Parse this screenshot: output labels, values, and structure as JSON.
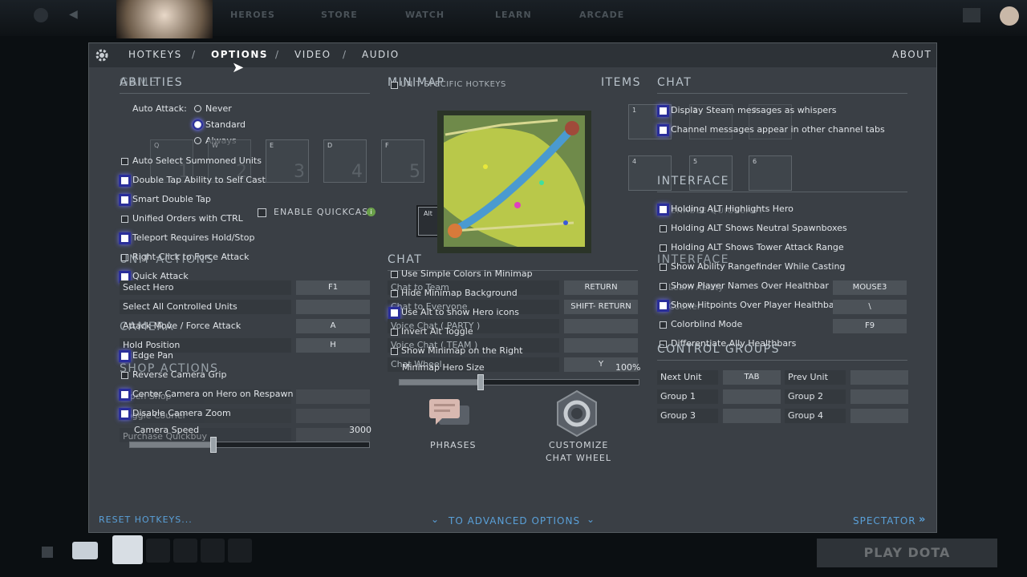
{
  "topnav": [
    "HEROES",
    "STORE",
    "WATCH",
    "LEARN",
    "ARCADE"
  ],
  "tabs": {
    "hotkeys": "HOTKEYS",
    "options": "OPTIONS",
    "video": "VIDEO",
    "audio": "AUDIO",
    "about": "ABOUT",
    "sep": "/"
  },
  "headers": {
    "abilities": "ABILITIES",
    "game": "GAME",
    "minimap": "MINIMAP",
    "items": "ITEMS",
    "chat": "CHAT",
    "interface": "INTERFACE",
    "unit_actions": "UNIT ACTIONS",
    "camera": "CAMERA",
    "shop_actions": "SHOP ACTIONS",
    "chat2": "CHAT",
    "interface2": "INTERFACE",
    "control_groups": "CONTROL GROUPS"
  },
  "unit_specific": "UNIT SPECIFIC HOTKEYS",
  "auto_attack": {
    "label": "Auto Attack:",
    "options": [
      "Never",
      "Standard",
      "Always"
    ],
    "selected": "Standard"
  },
  "ability_slots": [
    {
      "key": "Q",
      "num": ""
    },
    {
      "key": "W",
      "num": "2"
    },
    {
      "key": "E",
      "num": "3"
    },
    {
      "key": "D",
      "num": "4"
    },
    {
      "key": "F",
      "num": "5"
    }
  ],
  "ghost_slot_num": "1",
  "game_options": [
    "Auto Select Summoned Units",
    "Double Tap Ability to Self Cast",
    "Smart Double Tap",
    "Unified Orders with CTRL",
    "Teleport Requires Hold/Stop",
    "Right-Click to Force Attack",
    "Quick Attack"
  ],
  "enable_quickcast": "ENABLE QUICKCAST",
  "alt_key": "Alt",
  "unit_actions": [
    {
      "label": "Select Hero",
      "key": "F1"
    },
    {
      "label": "Select All Controlled Units",
      "key": ""
    },
    {
      "label": "Attack Move / Force Attack",
      "key": "A"
    },
    {
      "label": "Hold Position",
      "key": "H"
    }
  ],
  "camera_options": [
    "Edge Pan",
    "Reverse Camera Grip",
    "Center Camera on Hero on Respawn",
    "Disable Camera Zoom"
  ],
  "shop_ghost": [
    "Open Shop",
    "Toggle Courier",
    "Purchase Quickbuy"
  ],
  "camera_speed": {
    "label": "Camera Speed",
    "value": "3000",
    "fraction": 0.35
  },
  "minimap_options": [
    "Use Simple Colors in Minimap",
    "Hide Minimap Background",
    "Use Alt to show Hero icons",
    "Invert Alt Toggle",
    "Show Minimap on the Right"
  ],
  "chat_hotkeys": [
    {
      "label": "Chat to Team",
      "key": "RETURN"
    },
    {
      "label": "Chat to Everyone",
      "key": "SHIFT- RETURN"
    },
    {
      "label": "Voice Chat ( PARTY )",
      "key": ""
    },
    {
      "label": "Voice Chat ( TEAM )",
      "key": ""
    },
    {
      "label": "Chat Wheel",
      "key": "Y"
    }
  ],
  "minimap_hero_size": {
    "label": "Minimap Hero Size",
    "value": "100%",
    "fraction": 0.34
  },
  "phrases": "PHRASES",
  "customize_chat_wheel": [
    "CUSTOMIZE",
    "CHAT WHEEL"
  ],
  "item_slots": [
    "1",
    "2",
    "3",
    "4",
    "5",
    "6"
  ],
  "chat_options": [
    "Display Steam messages as whispers",
    "Channel messages appear in other channel tabs"
  ],
  "interface_options": [
    "Holding ALT Highlights Hero",
    "Holding ALT Shows Neutral Spawnboxes",
    "Holding ALT Shows Tower Attack Range",
    "Show Ability Rangefinder While Casting",
    "Show Player Names Over Healthbar",
    "Show Hitpoints Over Player Healthbar",
    "Colorblind Mode",
    "Differentiate Ally Healthbars"
  ],
  "interface_ghost": [
    "ENABLE QUICKCAST",
    "Learn Ability",
    "Courier",
    "Shop"
  ],
  "interface_hotkeys": [
    {
      "label": "Learn Ability",
      "key": "MOUSE3"
    },
    {
      "label": "Courier",
      "key": "\\"
    },
    {
      "label": "Shop",
      "key": "F9"
    }
  ],
  "control_groups": [
    {
      "label": "Next Unit",
      "key": "TAB"
    },
    {
      "label": "Prev Unit",
      "key": ""
    },
    {
      "label": "Group 1",
      "key": ""
    },
    {
      "label": "Group 2",
      "key": ""
    },
    {
      "label": "Group 3",
      "key": ""
    },
    {
      "label": "Group 4",
      "key": ""
    }
  ],
  "footer": {
    "reset": "RESET HOTKEYS...",
    "advanced": "TO ADVANCED OPTIONS",
    "spectator": "SPECTATOR"
  },
  "play_button": "PLAY DOTA",
  "colors": {
    "panel": "#3a3f45",
    "accent_link": "#5aa0d8",
    "checkbox_glow": "#6a6ef0"
  }
}
